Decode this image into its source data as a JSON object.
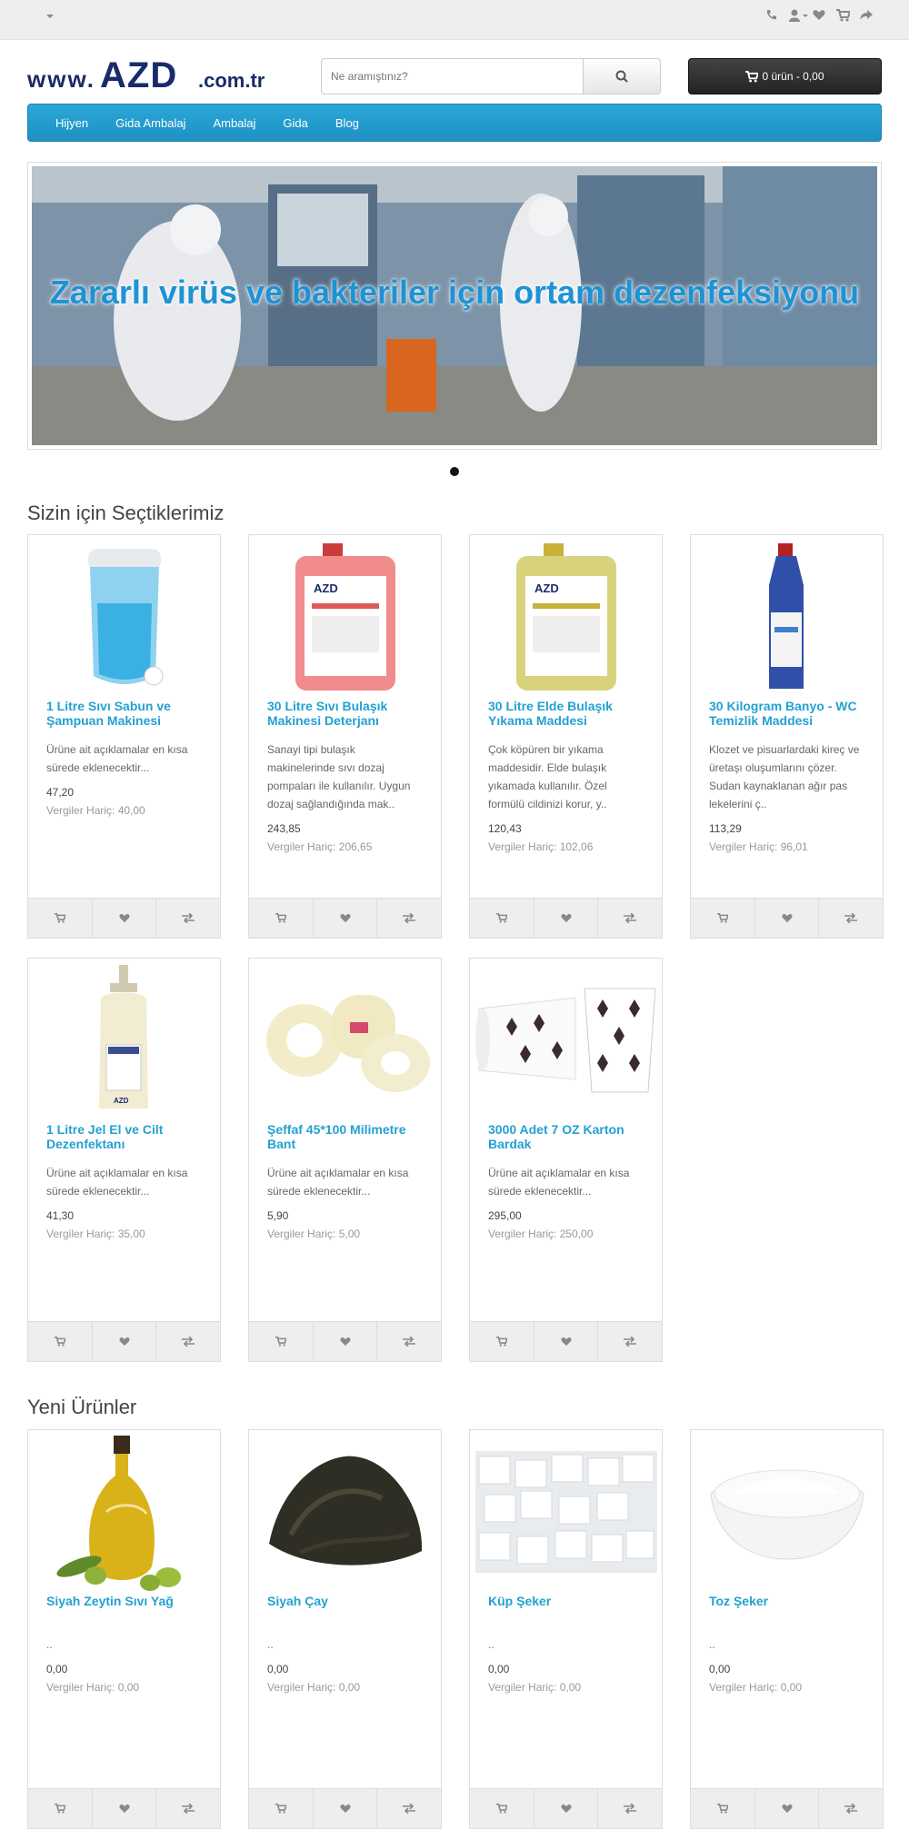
{
  "topbar": {
    "currency_icon": "caret-down-icon",
    "links": [
      "phone-icon",
      "user-icon",
      "heart-icon",
      "cart-icon",
      "share-icon"
    ]
  },
  "header": {
    "logo": {
      "prefix": "www.",
      "brand": "AZD",
      "suffix": ".com.tr"
    },
    "search": {
      "placeholder": "Ne aramıştınız?"
    },
    "cart": {
      "label": "0 ürün - 0,00"
    }
  },
  "menu": {
    "items": [
      "Hijyen",
      "Gida Ambalaj",
      "Ambalaj",
      "Gida",
      "Blog"
    ]
  },
  "banner": {
    "caption": "Zararlı virüs ve bakteriler için ortam dezenfeksiyonu"
  },
  "featured": {
    "title": "Sizin için Seçtiklerimiz",
    "products": [
      {
        "name": "1 Litre Sıvı Sabun ve Şampuan Makinesi",
        "desc": "Ürüne ait açıklamalar en kısa sürede eklenecektir...",
        "price": "47,20",
        "tax": "Vergiler Hariç: 40,00"
      },
      {
        "name": "30 Litre Sıvı Bulaşık Makinesi Deterjanı",
        "desc": "Sanayi tipi bulaşık makinelerinde sıvı dozaj pompaları ile kullanılır. Uygun dozaj sağlandığında mak..",
        "price": "243,85",
        "tax": "Vergiler Hariç: 206,65"
      },
      {
        "name": "30 Litre Elde Bulaşık Yıkama Maddesi",
        "desc": "Çok köpüren bir yıkama maddesidir. Elde bulaşık yıkamada kullanılır. Özel formülü cildinizi korur, y..",
        "price": "120,43",
        "tax": "Vergiler Hariç: 102,06"
      },
      {
        "name": "30 Kilogram Banyo - WC Temizlik Maddesi",
        "desc": "Klozet ve pisuarlardaki kireç ve üretaşı oluşumlarını çözer. Sudan kaynaklanan ağır pas lekelerini ç..",
        "price": "113,29",
        "tax": "Vergiler Hariç: 96,01"
      },
      {
        "name": "1 Litre Jel El ve Cilt Dezenfektanı",
        "desc": "Ürüne ait açıklamalar en kısa sürede eklenecektir...",
        "price": "41,30",
        "tax": "Vergiler Hariç: 35,00"
      },
      {
        "name": "Şeffaf 45*100 Milimetre Bant",
        "desc": "Ürüne ait açıklamalar en kısa sürede eklenecektir...",
        "price": "5,90",
        "tax": "Vergiler Hariç: 5,00"
      },
      {
        "name": "3000 Adet 7 OZ Karton Bardak",
        "desc": "Ürüne ait açıklamalar en kısa sürede eklenecektir...",
        "price": "295,00",
        "tax": "Vergiler Hariç: 250,00"
      }
    ]
  },
  "latest": {
    "title": "Yeni Ürünler",
    "products": [
      {
        "name": "Siyah Zeytin Sıvı Yağ",
        "desc": "..",
        "price": "0,00",
        "tax": "Vergiler Hariç: 0,00"
      },
      {
        "name": "Siyah Çay",
        "desc": "..",
        "price": "0,00",
        "tax": "Vergiler Hariç: 0,00"
      },
      {
        "name": "Küp Şeker",
        "desc": "..",
        "price": "0,00",
        "tax": "Vergiler Hariç: 0,00"
      },
      {
        "name": "Toz Şeker",
        "desc": "..",
        "price": "0,00",
        "tax": "Vergiler Hariç: 0,00"
      }
    ]
  },
  "card_buttons": [
    "cart-icon",
    "heart-icon",
    "compare-icon"
  ],
  "colors": {
    "accent": "#23a1d1",
    "menu": "#2aa8d8",
    "cart_button": "#333333"
  }
}
